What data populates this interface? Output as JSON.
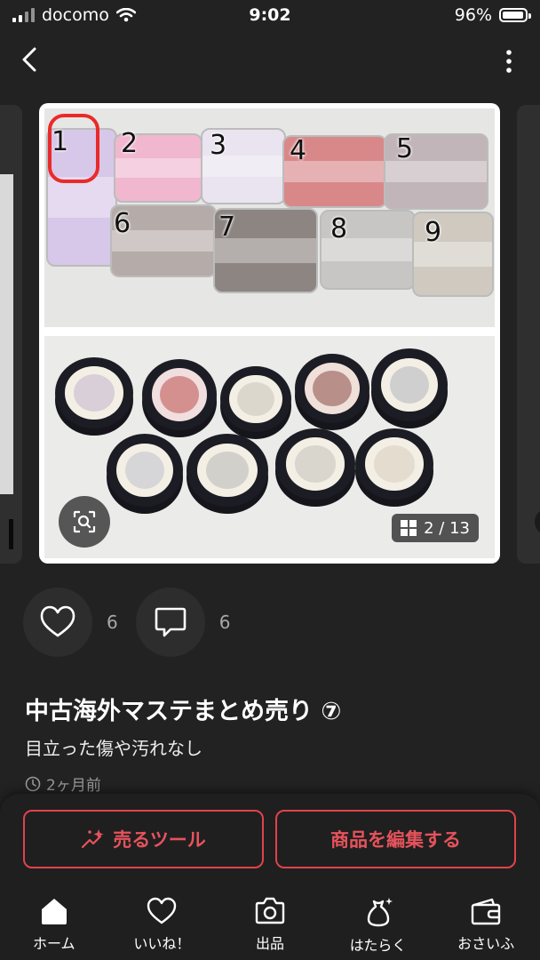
{
  "status_bar": {
    "carrier": "docomo",
    "time": "9:02",
    "battery": "96%"
  },
  "gallery": {
    "pager": "2 / 13",
    "image_numbers": [
      "1",
      "2",
      "3",
      "4",
      "5",
      "6",
      "7",
      "8",
      "9"
    ]
  },
  "reactions": {
    "likes": "6",
    "comments": "6"
  },
  "item": {
    "title": "中古海外マステまとめ売り ⑦",
    "description": "目立った傷や汚れなし",
    "posted": "2ヶ月前"
  },
  "actions": {
    "sell_tool": "売るツール",
    "edit_item": "商品を編集する"
  },
  "tabbar": {
    "home": "ホーム",
    "likes": "いいね！",
    "sell": "出品",
    "work": "はたらく",
    "wallet": "おさいふ"
  },
  "colors": {
    "accent": "#e1424c",
    "background": "#222222"
  }
}
